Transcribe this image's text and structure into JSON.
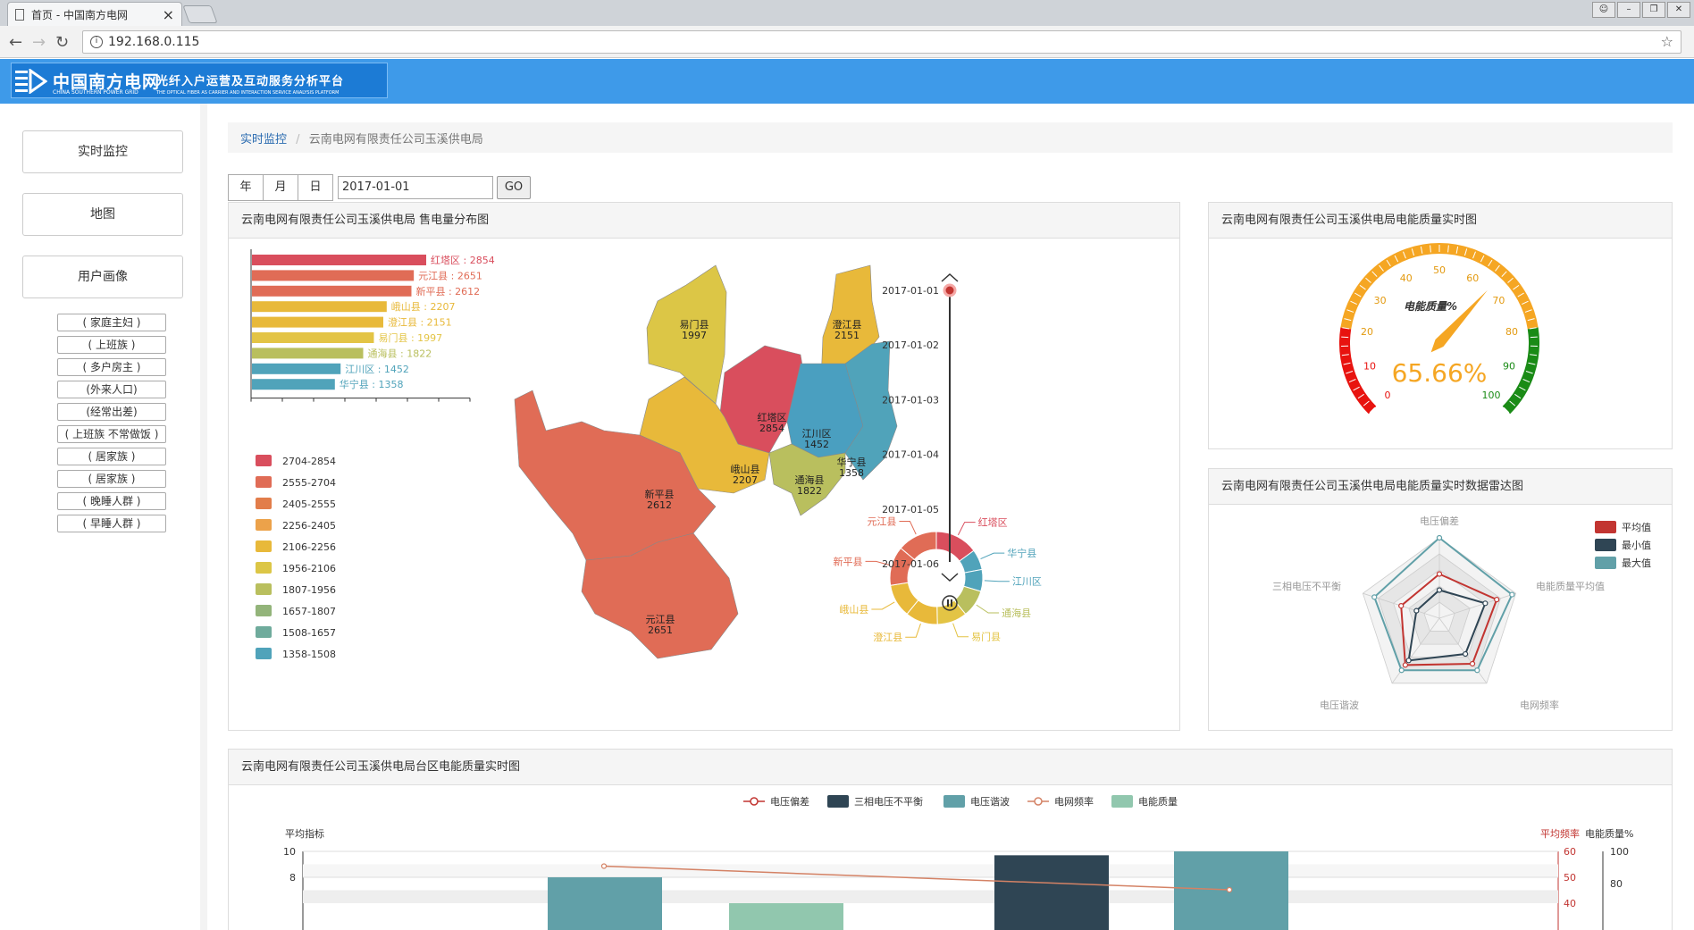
{
  "browser": {
    "tab_title": "首页 - 中国南方电网",
    "url": "192.168.0.115"
  },
  "header": {
    "logo_cn": "中国南方电网",
    "logo_en": "CHINA SOUTHERN POWER GRID",
    "platform_title": "光纤入户运营及互动服务分析平台",
    "platform_en": "THE OPTICAL FIBER AS CARRIER AND INTERACTION SERVICE ANALYSIS PLATFORM"
  },
  "sidebar": {
    "buttons": [
      "实时监控",
      "地图",
      "用户画像"
    ],
    "tags": [
      "( 家庭主妇 )",
      "( 上班族 )",
      "( 多户房主 )",
      "(外来人口)",
      "(经常出差)",
      "( 上班族 不常做饭 )",
      "( 居家族 )",
      "( 居家族 )",
      "( 晚睡人群 )",
      "( 早睡人群 )"
    ]
  },
  "breadcrumb": {
    "link": "实时监控",
    "current": "云南电网有限责任公司玉溪供电局"
  },
  "datebar": {
    "year": "年",
    "month": "月",
    "day": "日",
    "date_value": "2017-01-01",
    "go": "GO"
  },
  "panels": {
    "map_title": "云南电网有限责任公司玉溪供电局 售电量分布图",
    "gauge_title": "云南电网有限责任公司玉溪供电局电能质量实时图",
    "radar_title": "云南电网有限责任公司玉溪供电局电能质量实时数据雷达图",
    "bottom_title": "云南电网有限责任公司玉溪供电局台区电能质量实时图"
  },
  "colors": {
    "red": "#d94e5d",
    "orange": "#e06c56",
    "yellow": "#e8b93a",
    "olive": "#b9bf5e",
    "blue": "#50a3ba"
  },
  "chart_data": [
    {
      "type": "bar",
      "orientation": "horizontal",
      "categories": [
        "红塔区",
        "元江县",
        "新平县",
        "峨山县",
        "澄江县",
        "易门县",
        "通海县",
        "江川区",
        "华宁县"
      ],
      "values": [
        2854,
        2651,
        2612,
        2207,
        2151,
        1997,
        1822,
        1452,
        1358
      ],
      "bar_labels": [
        "红塔区 : 2854",
        "元江县 : 2651",
        "新平县 : 2612",
        "峨山县 : 2207",
        "澄江县 : 2151",
        "易门县 : 1997",
        "通海县 : 1822",
        "江川区 : 1452",
        "华宁县 : 1358"
      ],
      "bar_colors": [
        "#d94e5d",
        "#e06c56",
        "#e06c56",
        "#e8b93a",
        "#e8b93a",
        "#e3c445",
        "#b9bf5e",
        "#50a3ba",
        "#50a3ba"
      ]
    },
    {
      "type": "table",
      "name": "map",
      "regions": [
        {
          "name": "易门县",
          "value": "1997",
          "color": "#dcc646"
        },
        {
          "name": "澄江县",
          "value": "2151",
          "color": "#e8b93a"
        },
        {
          "name": "红塔区",
          "value": "2854",
          "color": "#d94e5d"
        },
        {
          "name": "江川区",
          "value": "1452",
          "color": "#4a9fc0"
        },
        {
          "name": "华宁县",
          "value": "1358",
          "color": "#50a3ba"
        },
        {
          "name": "峨山县",
          "value": "2207",
          "color": "#e8b93a"
        },
        {
          "name": "通海县",
          "value": "1822",
          "color": "#b9bf5e"
        },
        {
          "name": "新平县",
          "value": "2612",
          "color": "#e06c56"
        },
        {
          "name": "元江县",
          "value": "2651",
          "color": "#e06c56"
        }
      ],
      "legend": [
        {
          "label": "2704-2854",
          "color": "#d94e5d"
        },
        {
          "label": "2555-2704",
          "color": "#e06c56"
        },
        {
          "label": "2405-2555",
          "color": "#e27d4a"
        },
        {
          "label": "2256-2405",
          "color": "#eca24a"
        },
        {
          "label": "2106-2256",
          "color": "#e8b93a"
        },
        {
          "label": "1956-2106",
          "color": "#dcc646"
        },
        {
          "label": "1807-1956",
          "color": "#b9bf5e"
        },
        {
          "label": "1657-1807",
          "color": "#93b47a"
        },
        {
          "label": "1508-1657",
          "color": "#6fab9c"
        },
        {
          "label": "1358-1508",
          "color": "#50a3ba"
        }
      ]
    },
    {
      "type": "pie",
      "labels": [
        "红塔区",
        "华宁县",
        "江川区",
        "通海县",
        "易门县",
        "澄江县",
        "峨山县",
        "新平县",
        "元江县"
      ],
      "values": [
        2854,
        1358,
        1452,
        1822,
        1997,
        2151,
        2207,
        2612,
        2651
      ],
      "colors": [
        "#d94e5d",
        "#50a3ba",
        "#50a3ba",
        "#b9bf5e",
        "#e3c445",
        "#e8b93a",
        "#e8b93a",
        "#e06c56",
        "#e06c56"
      ]
    },
    {
      "type": "table",
      "name": "timeline",
      "dates": [
        "2017-01-01",
        "2017-01-02",
        "2017-01-03",
        "2017-01-04",
        "2017-01-05",
        "2017-01-06"
      ],
      "current": "2017-01-01"
    },
    {
      "type": "gauge",
      "label": "电能质量%",
      "value": 65.66,
      "value_text": "65.66%",
      "min": 0,
      "max": 100,
      "ticks": [
        "0",
        "10",
        "20",
        "30",
        "40",
        "50",
        "60",
        "70",
        "80",
        "90",
        "100"
      ]
    },
    {
      "type": "radar",
      "indicators": [
        "电压偏差",
        "电能质量平均值",
        "电网频率",
        "电压谐波",
        "三相电压不平衡"
      ],
      "series": [
        {
          "name": "平均值",
          "color": "#c23531",
          "values": [
            0.55,
            0.75,
            0.7,
            0.72,
            0.5
          ]
        },
        {
          "name": "最小值",
          "color": "#2f4554",
          "values": [
            0.35,
            0.6,
            0.55,
            0.65,
            0.3
          ]
        },
        {
          "name": "最大值",
          "color": "#61a0a8",
          "values": [
            1.0,
            0.95,
            0.8,
            0.8,
            0.85
          ]
        }
      ]
    },
    {
      "type": "bar",
      "legend": [
        "电压偏差",
        "三相电压不平衡",
        "电压谐波",
        "电网频率",
        "电能质量"
      ],
      "legend_colors": [
        "#c23531",
        "#2f4554",
        "#61a0a8",
        "#d48265",
        "#91c7ae"
      ],
      "ylabel": "平均指标",
      "ylabel_right1": "平均频率",
      "ylabel_right2": "电能质量%",
      "y_ticks": [
        "10",
        "8"
      ],
      "y_right1_ticks": [
        "60",
        "50",
        "40"
      ],
      "y_right2_ticks": [
        "100",
        "80"
      ],
      "bars": [
        {
          "series": "电压谐波",
          "value": 8.0,
          "color": "#61a0a8"
        },
        {
          "series": "电能质量",
          "value": 6.0,
          "color": "#91c7ae"
        },
        {
          "series": "三相电压不平衡",
          "value": 9.7,
          "color": "#2f4554"
        },
        {
          "series": "电压谐波",
          "value": 10.0,
          "color": "#61a0a8"
        }
      ],
      "line_values": [
        55,
        50
      ]
    }
  ]
}
